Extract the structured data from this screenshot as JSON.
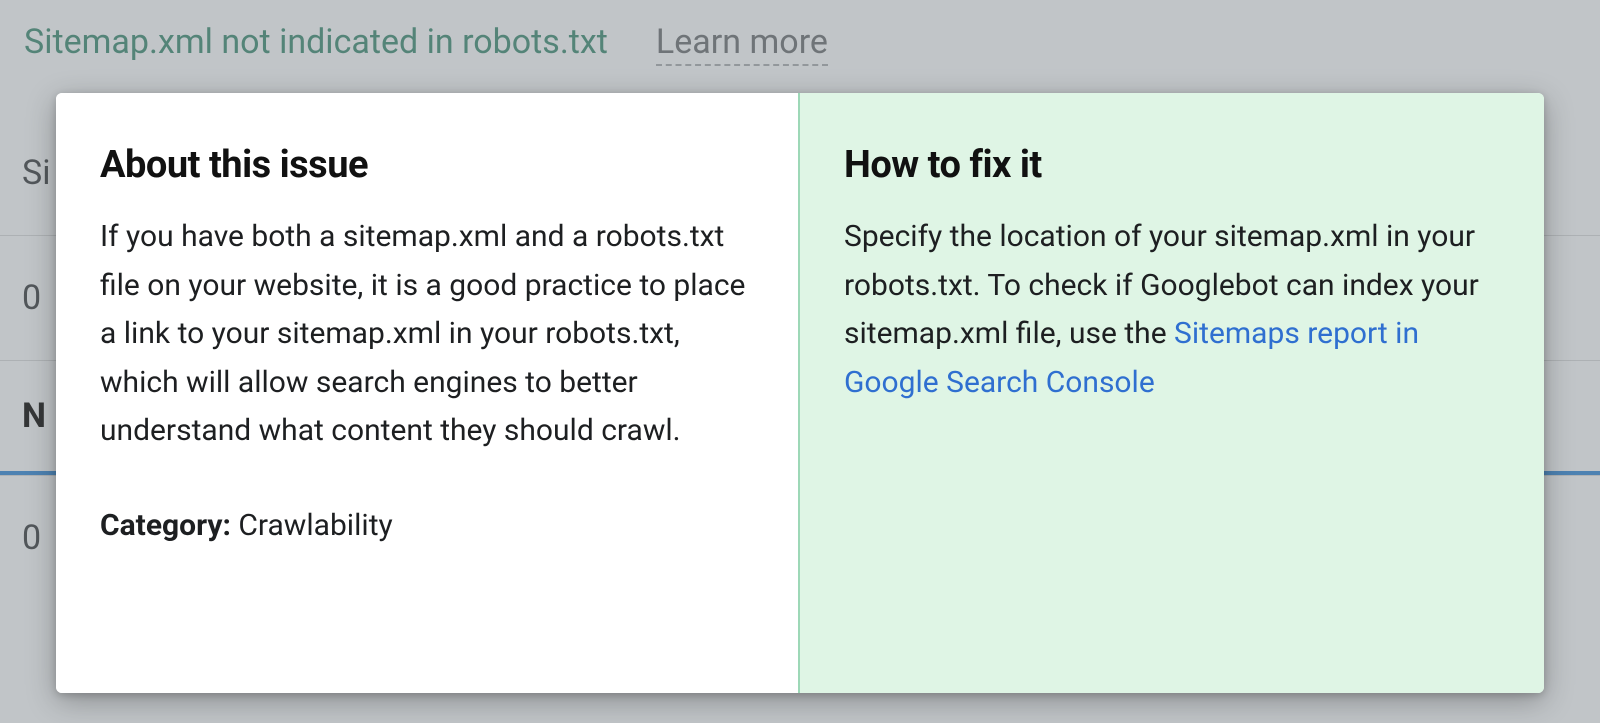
{
  "background": {
    "issue_title": "Sitemap.xml not indicated in robots.txt",
    "learn_more": "Learn more",
    "rows": [
      "Si",
      "0",
      "N",
      "0"
    ]
  },
  "popover": {
    "about": {
      "heading": "About this issue",
      "body": "If you have both a sitemap.xml and a robots.txt file on your website, it is a good practice to place a link to your sitemap.xml in your robots.txt, which will allow search engines to better understand what content they should crawl.",
      "category_label": "Category:",
      "category_value": "Crawlability"
    },
    "fix": {
      "heading": "How to fix it",
      "body_pre": "Specify the location of your sitemap.xml in your robots.txt. To check if Googlebot can index your sitemap.xml file, use the ",
      "link_text": "Sitemaps report in Google Search Console"
    }
  }
}
